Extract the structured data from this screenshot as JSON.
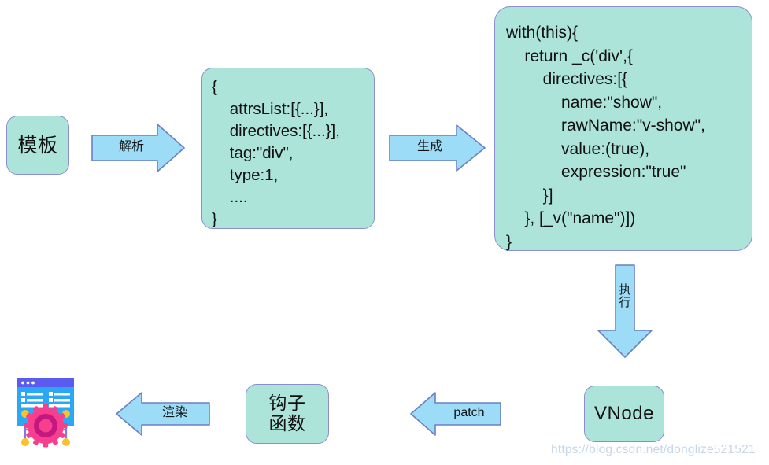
{
  "diagram": {
    "title": "Vue template to DOM rendering pipeline",
    "background_color": "#ffffff",
    "box_fill": "#ade4da",
    "box_border": "#8a8fd0",
    "arrow_fill": "#9cdcf7",
    "arrow_border": "#6b7fc4"
  },
  "nodes": {
    "template": {
      "label": "模板"
    },
    "ast": {
      "code": "{\n    attrsList:[{...}],\n    directives:[{...}],\n    tag:\"div\",\n    type:1,\n    ....\n}"
    },
    "render_function": {
      "code": "with(this){\n    return _c('div',{\n        directives:[{\n            name:\"show\",\n            rawName:\"v-show\",\n            value:(true),\n            expression:\"true\"\n        }]\n    }, [_v(\"name\")])\n}"
    },
    "vnode": {
      "label": "VNode"
    },
    "hook_functions": {
      "label": "钩子\n函数"
    },
    "browser_output": {
      "label": "browser-page-icon"
    }
  },
  "arrows": {
    "parse": {
      "label": "解析",
      "direction": "right"
    },
    "generate": {
      "label": "生成",
      "direction": "right"
    },
    "execute": {
      "label": "执\n行",
      "direction": "down"
    },
    "patch": {
      "label": "patch",
      "direction": "left"
    },
    "render": {
      "label": "渲染",
      "direction": "left"
    }
  },
  "watermark": {
    "text": "https://blog.csdn.net/donglize521521"
  }
}
